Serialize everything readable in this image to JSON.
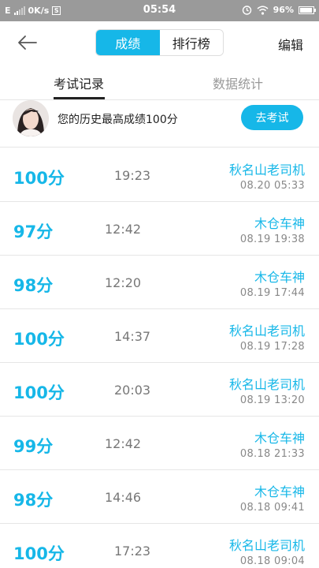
{
  "status_bar": {
    "carrier": "E",
    "net_speed": "0K/s",
    "sim_icon": "S",
    "time": "05:54",
    "battery": "96%",
    "icons": [
      "signal-icon",
      "alarm-icon",
      "wifi-icon",
      "battery-icon"
    ]
  },
  "header": {
    "tabs": [
      "成绩",
      "排行榜"
    ],
    "active_tab": "成绩",
    "edit_label": "编辑",
    "back_icon": "arrow-left-icon"
  },
  "tabs": {
    "records": "考试记录",
    "stats": "数据统计",
    "active": "考试记录"
  },
  "best": {
    "text": "您的历史最高成绩100分",
    "button": "去考试"
  },
  "records": [
    {
      "score": "100分",
      "duration": "19:23",
      "name": "秋名山老司机",
      "date": "08.20  05:33"
    },
    {
      "score": "97分",
      "duration": "12:42",
      "name": "木仓车神",
      "date": "08.19  19:38"
    },
    {
      "score": "98分",
      "duration": "12:20",
      "name": "木仓车神",
      "date": "08.19  17:44"
    },
    {
      "score": "100分",
      "duration": "14:37",
      "name": "秋名山老司机",
      "date": "08.19  17:28"
    },
    {
      "score": "100分",
      "duration": "20:03",
      "name": "秋名山老司机",
      "date": "08.19  13:20"
    },
    {
      "score": "99分",
      "duration": "12:42",
      "name": "木仓车神",
      "date": "08.18  21:33"
    },
    {
      "score": "98分",
      "duration": "14:46",
      "name": "木仓车神",
      "date": "08.18  09:41"
    },
    {
      "score": "100分",
      "duration": "17:23",
      "name": "秋名山老司机",
      "date": "08.18  09:04"
    }
  ],
  "colors": {
    "accent": "#16b7e8",
    "status_bar": "#9a9a9a"
  }
}
